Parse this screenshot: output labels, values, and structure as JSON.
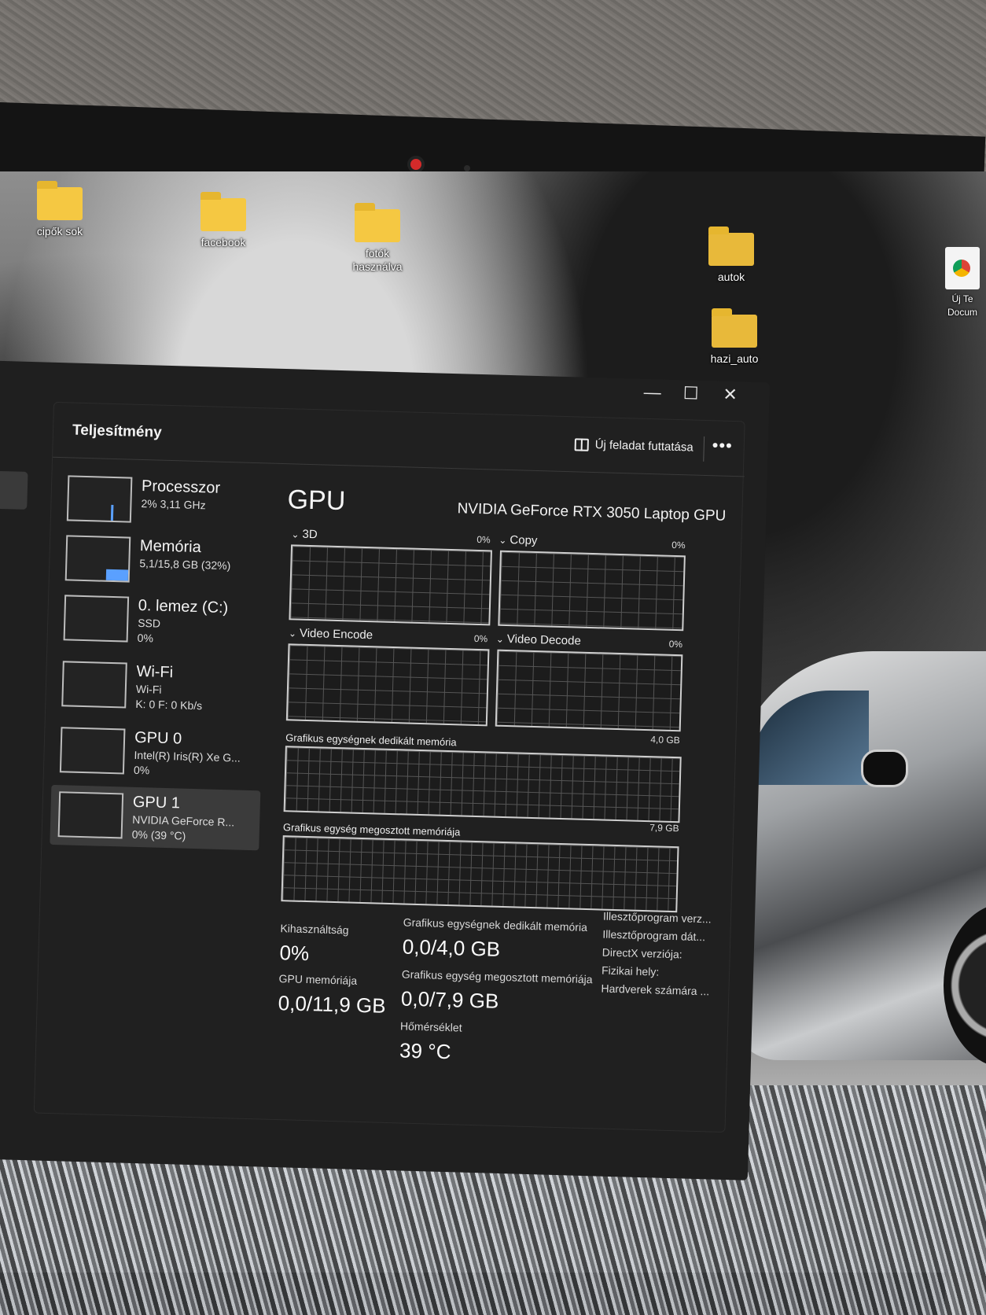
{
  "desktop": {
    "icons": [
      {
        "label": "cipők sok"
      },
      {
        "label": "facebook"
      },
      {
        "label": "fotók használva"
      },
      {
        "label": "autok"
      },
      {
        "label": "hazi_auto"
      },
      {
        "label": "Új Te Docum"
      }
    ]
  },
  "window": {
    "minimize": "—",
    "maximize": "☐",
    "close": "✕"
  },
  "header": {
    "title": "Teljesítmény",
    "run_task_label": "Új feladat futtatása",
    "more_label": "•••"
  },
  "sidebar": {
    "items": [
      {
        "name": "Processzor",
        "sub1": "2% 3,11 GHz",
        "sub2": "",
        "sub3": ""
      },
      {
        "name": "Memória",
        "sub1": "5,1/15,8 GB (32%)",
        "sub2": "",
        "sub3": ""
      },
      {
        "name": "0. lemez (C:)",
        "sub1": "SSD",
        "sub2": "0%",
        "sub3": ""
      },
      {
        "name": "Wi-Fi",
        "sub1": "Wi-Fi",
        "sub2": "K: 0 F: 0 Kb/s",
        "sub3": ""
      },
      {
        "name": "GPU 0",
        "sub1": "Intel(R) Iris(R) Xe G...",
        "sub2": "0%",
        "sub3": ""
      },
      {
        "name": "GPU 1",
        "sub1": "NVIDIA GeForce R...",
        "sub2": "0% (39 °C)",
        "sub3": ""
      }
    ],
    "selected_index": 5
  },
  "gpu": {
    "title": "GPU",
    "model": "NVIDIA GeForce RTX 3050 Laptop GPU",
    "graphs": {
      "g3d": {
        "label": "3D",
        "pct": "0%"
      },
      "copy": {
        "label": "Copy",
        "pct": "0%"
      },
      "encode": {
        "label": "Video Encode",
        "pct": "0%"
      },
      "decode": {
        "label": "Video Decode",
        "pct": "0%"
      },
      "dedicated": {
        "label": "Grafikus egységnek dedikált memória",
        "max": "4,0 GB"
      },
      "shared": {
        "label": "Grafikus egység megosztott memóriája",
        "max": "7,9 GB"
      }
    },
    "stats": {
      "util_label": "Kihasználtság",
      "util_value": "0%",
      "mem_label": "GPU memóriája",
      "mem_value": "0,0/11,9 GB",
      "ded_label": "Grafikus egységnek dedikált memória",
      "ded_value": "0,0/4,0 GB",
      "shared_label": "Grafikus egység megosztott memóriája",
      "shared_value": "0,0/7,9 GB",
      "temp_label": "Hőmérséklet",
      "temp_value": "39 °C"
    },
    "properties": [
      "Illesztőprogram verz...",
      "Illesztőprogram dát...",
      "DirectX verziója:",
      "Fizikai hely:",
      "Hardverek számára ..."
    ]
  },
  "colors": {
    "window_bg": "#202020",
    "accent": "#5aa0ff",
    "folder": "#f5c842"
  }
}
